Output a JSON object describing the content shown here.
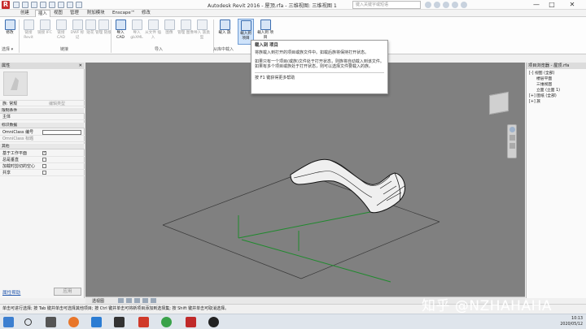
{
  "titlebar": {
    "app_letter": "R",
    "title": "Autodesk Revit 2016 -   屋顶.rfa - 三维视图: 三维视图 1",
    "search_placeholder": "键入关键字或短语",
    "minimize": "—",
    "maximize": "□",
    "close": "✕"
  },
  "tabs": [
    {
      "label": "创建"
    },
    {
      "label": "插入"
    },
    {
      "label": "视图"
    },
    {
      "label": "管理"
    },
    {
      "label": "附加模块"
    },
    {
      "label": "Enscape™"
    },
    {
      "label": "修改"
    }
  ],
  "ribbon": {
    "buttons": [
      {
        "label": "修改"
      },
      {
        "label": "链接 Revit"
      },
      {
        "label": "链接 IFC"
      },
      {
        "label": "链接 CAD"
      },
      {
        "label": "DWF 标记"
      },
      {
        "label": "贴花"
      },
      {
        "label": "管理 链接"
      },
      {
        "label": "导入 CAD"
      },
      {
        "label": "导入 gbXML"
      },
      {
        "label": "从文件 插入"
      },
      {
        "label": "图像"
      },
      {
        "label": "管理 图像"
      },
      {
        "label": "导入 族类型"
      },
      {
        "label": "载入 族"
      },
      {
        "label": "载入到 项目"
      },
      {
        "label": "载入到 项目"
      }
    ],
    "panels": [
      "选择 ▾",
      "链接",
      "导入",
      "从库中载入"
    ]
  },
  "tooltip": {
    "title": "载入到 项目",
    "line1": "将族载入到打开的项目或族文件中。如载后族将保持打开状态。",
    "line2": "如果只有一个项目(或族)文件处于打开状态，则族将自动载入到该文件。如果有多个项目或族处于打开状态，则可以选择文件要载入的族。",
    "help": "按 F1 键获得更多帮助"
  },
  "properties": {
    "header": "属性",
    "close": "✕",
    "family_label": "族: 常规",
    "edit_type": "编辑类型",
    "sections": [
      {
        "title": "限制条件"
      },
      {
        "title": "标识数据"
      },
      {
        "title": "其他"
      }
    ],
    "rows": {
      "host": "主体",
      "omni_number": "OmniClass 编号",
      "omni_title": "OmniClass 标题",
      "work_plane": "基于工作平面",
      "vertical": "总是垂直",
      "cut_voids": "加载时剪切的空心",
      "shared": "共享"
    },
    "help_link": "属性帮助",
    "apply": "应用"
  },
  "browser": {
    "header": "项目浏览器 - 屋顶.rfa",
    "items": [
      {
        "label": "[-] 视图 (全部)"
      },
      {
        "label": "楼层平面"
      },
      {
        "label": "三维视图"
      },
      {
        "label": "立面 (立面 1)"
      },
      {
        "label": "[+] 图纸 (全部)"
      },
      {
        "label": "[+] 族"
      }
    ]
  },
  "viewbar": {
    "scale": "透视图"
  },
  "status": {
    "text": "单击可进行选择; 按 Tab 键并单击可选择其他项目; 按 Ctrl 键并单击可将新项目添加到选择集; 按 Shift 键并单击可取消选择。"
  },
  "clock": {
    "time": "10:13",
    "date": "2020/05/12"
  },
  "watermark": "知乎 @NZHAHAHA"
}
